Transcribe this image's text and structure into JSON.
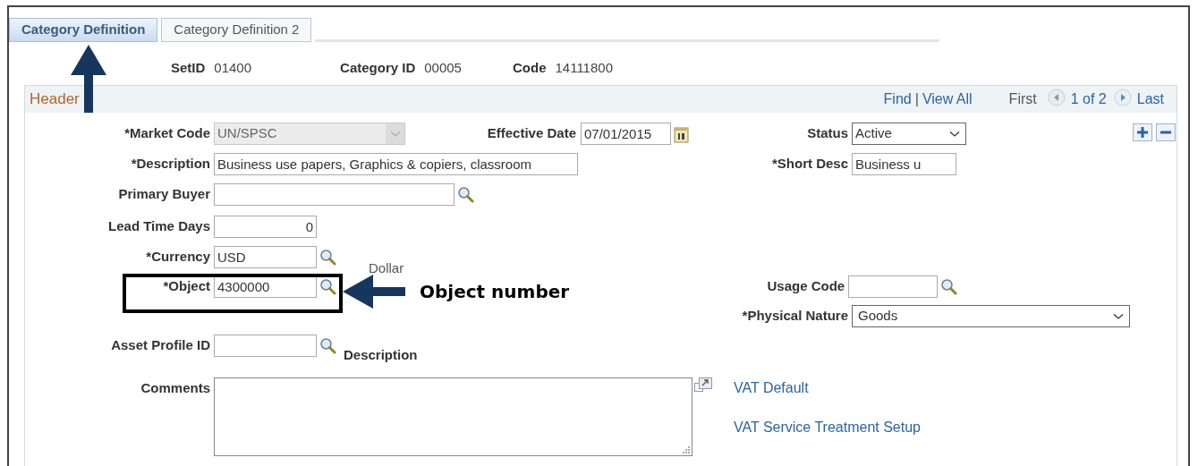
{
  "tabs": [
    {
      "label": "Category Definition",
      "selected": true
    },
    {
      "label": "Category Definition 2",
      "selected": false
    }
  ],
  "keys": [
    {
      "label": "SetID",
      "value": "01400"
    },
    {
      "label": "Category ID",
      "value": "00005"
    },
    {
      "label": "Code",
      "value": "14111800"
    }
  ],
  "header": {
    "title": "Header",
    "find": "Find",
    "separator": "|",
    "view_all": "View All",
    "first": "First",
    "position": "1 of 2",
    "last": "Last"
  },
  "form": {
    "market_code": {
      "label": "*Market Code",
      "value": "UN/SPSC",
      "disabled": true
    },
    "effective_date": {
      "label": "Effective Date",
      "value": "07/01/2015"
    },
    "status": {
      "label": "Status",
      "value": "Active"
    },
    "description": {
      "label": "*Description",
      "value": "Business use papers, Graphics & copiers, classroom"
    },
    "short_desc": {
      "label": "*Short Desc",
      "value": "Business u"
    },
    "primary_buyer": {
      "label": "Primary Buyer"
    },
    "lead_time_days": {
      "label": "Lead Time Days",
      "value": "0"
    },
    "currency": {
      "label": "*Currency",
      "value": "USD",
      "description": "Dollar"
    },
    "object": {
      "label": "*Object",
      "value": "4300000"
    },
    "usage_code": {
      "label": "Usage Code"
    },
    "physical_nature": {
      "label": "*Physical Nature",
      "value": "Goods"
    },
    "asset_profile_id": {
      "label": "Asset Profile ID",
      "description": "Description"
    },
    "comments": {
      "label": "Comments"
    },
    "links": [
      "VAT Default",
      "VAT Service Treatment Setup"
    ]
  },
  "annotation": {
    "callout": "Object number"
  }
}
